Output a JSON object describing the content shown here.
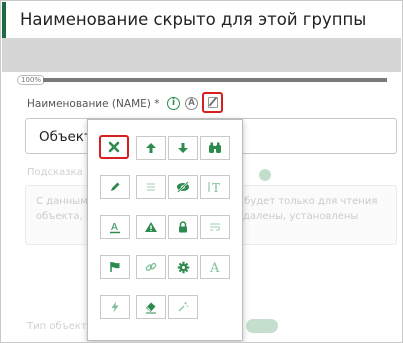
{
  "header": {
    "title": "Наименование скрыто для этой группы"
  },
  "progress": {
    "label": "100%",
    "value_percent": 100
  },
  "name_field": {
    "label": "Наименование (NAME) *",
    "info_icon": "info-icon",
    "info_glyph": "i",
    "auto_icon": "auto-translate-icon",
    "auto_glyph": "A",
    "edit_icon": "edit-icon",
    "value": "Объект"
  },
  "background": {
    "desc_label": "Подсказка",
    "desc_line1": "С данным типом объектов связывание будет только для чтения",
    "desc_line2": "объекта, перечисленные ниже будут удалены, установлены",
    "bottom_label": "Тип объекта"
  },
  "toolbar": {
    "rows": [
      [
        "close-icon",
        "arrow-up-icon",
        "arrow-down-icon",
        "binoculars-icon"
      ],
      [
        "pencil-icon",
        "list-icon",
        "eye-slash-icon",
        "text-height-icon"
      ],
      [
        "text-underline-icon",
        "warning-icon",
        "lock-icon",
        "wrap-text-icon"
      ],
      [
        "flag-icon",
        "link-icon",
        "gear-icon",
        "font-icon"
      ],
      [
        "bolt-icon",
        "eraser-icon",
        "magic-wand-icon"
      ]
    ],
    "glyphs": {
      "text_height": "T",
      "font": "A",
      "underline_letter": "A"
    },
    "highlighted": "close-icon"
  },
  "colors": {
    "accent": "#1e6b3f",
    "icon_green": "#2e8b4e",
    "highlight": "#d62020",
    "faded_icon": "#9fcfb0"
  }
}
